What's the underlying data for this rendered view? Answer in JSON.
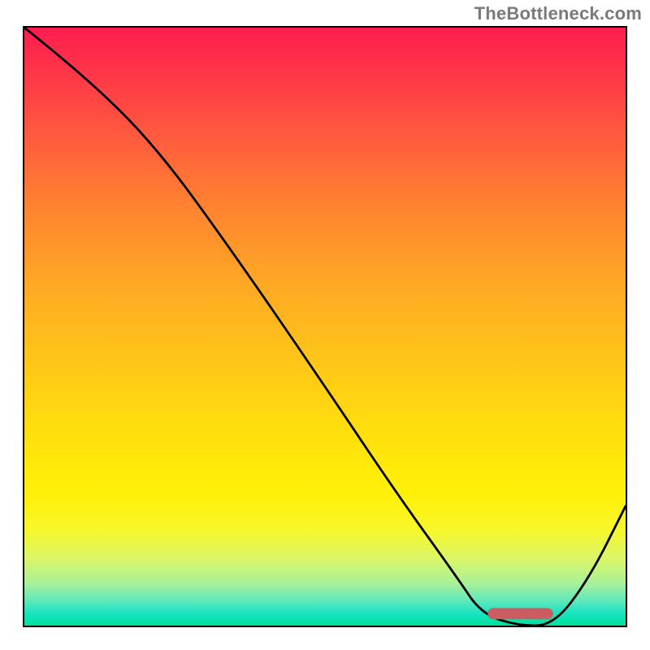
{
  "attribution": "TheBottleneck.com",
  "colors": {
    "gradient_top": "#ff1d4f",
    "gradient_mid": "#ffd810",
    "gradient_bottom": "#00e19a",
    "curve": "#000000",
    "marker": "#cb5d62",
    "axis": "#000000"
  },
  "chart_data": {
    "type": "line",
    "title": "",
    "xlabel": "",
    "ylabel": "",
    "xlim": [
      0,
      100
    ],
    "ylim": [
      0,
      100
    ],
    "series": [
      {
        "name": "bottleneck-curve",
        "x": [
          0,
          10,
          22,
          35,
          50,
          62,
          72,
          76,
          82,
          88,
          94,
          100
        ],
        "y": [
          100,
          92,
          80,
          62,
          40,
          22,
          8,
          2,
          0,
          0,
          8,
          20
        ]
      }
    ],
    "marker": {
      "name": "optimal-range",
      "x_start": 78,
      "x_end": 87,
      "y": 2
    },
    "background": {
      "type": "vertical-gradient",
      "stops": [
        {
          "pos": 0.0,
          "color": "#ff1d4f"
        },
        {
          "pos": 0.5,
          "color": "#ffd810"
        },
        {
          "pos": 0.85,
          "color": "#f7f72a"
        },
        {
          "pos": 1.0,
          "color": "#00e19a"
        }
      ]
    }
  }
}
